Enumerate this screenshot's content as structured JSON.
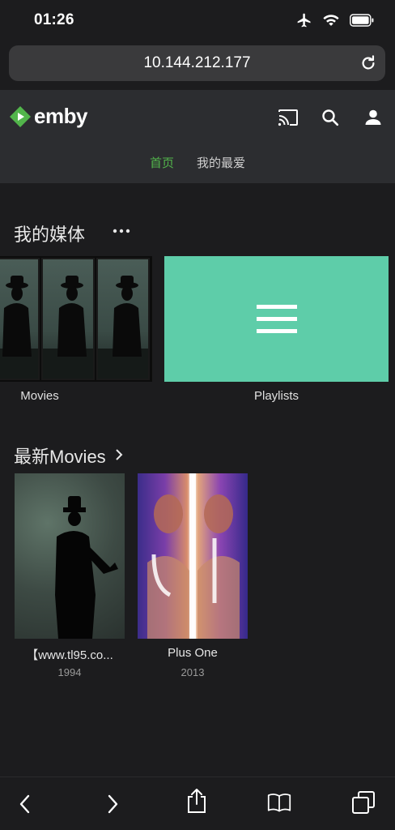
{
  "status": {
    "time": "01:26",
    "icons": [
      "airplane-icon",
      "wifi-icon",
      "battery-icon"
    ]
  },
  "browser": {
    "url": "10.144.212.177"
  },
  "header": {
    "logo_text": "emby",
    "brand_color": "#52b54b",
    "tabs": [
      {
        "label": "首页",
        "active": true
      },
      {
        "label": "我的最爱",
        "active": false
      }
    ]
  },
  "my_media": {
    "title": "我的媒体",
    "items": [
      {
        "label": "Movies"
      },
      {
        "label": "Playlists"
      }
    ]
  },
  "latest_movies": {
    "title": "最新Movies",
    "items": [
      {
        "title": "【www.tl95.co...",
        "year": "1994"
      },
      {
        "title": "Plus One",
        "year": "2013"
      }
    ]
  },
  "colors": {
    "playlist_tile": "#5ecda9",
    "header_bg": "#2c2d30",
    "page_bg": "#1c1c1e"
  }
}
